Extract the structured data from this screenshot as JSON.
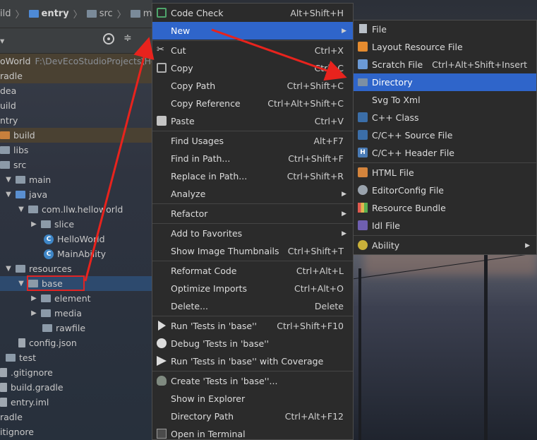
{
  "breadcrumb": {
    "seg0": "ild",
    "seg1": "entry",
    "seg2": "src",
    "seg3": "main"
  },
  "tree": {
    "root_label": "oWorld",
    "root_path": "F:\\DevEcoStudioProjects\\Hell",
    "rows": [
      "radle",
      "dea",
      "uild",
      "ntry",
      "build",
      "libs",
      "src",
      "main",
      "java",
      "com.llw.helloworld",
      "slice",
      "HelloWorld",
      "MainAbility",
      "resources",
      "base",
      "element",
      "media",
      "rawfile",
      "config.json",
      "test",
      ".gitignore",
      "build.gradle",
      "entry.iml",
      "radle",
      "itignore"
    ]
  },
  "menu": {
    "items": [
      {
        "label": "Code Check",
        "shortcut": "Alt+Shift+H"
      },
      {
        "label": "New",
        "shortcut": ""
      },
      {
        "label": "Cut",
        "shortcut": "Ctrl+X"
      },
      {
        "label": "Copy",
        "shortcut": "Ctrl+C"
      },
      {
        "label": "Copy Path",
        "shortcut": "Ctrl+Shift+C"
      },
      {
        "label": "Copy Reference",
        "shortcut": "Ctrl+Alt+Shift+C"
      },
      {
        "label": "Paste",
        "shortcut": "Ctrl+V"
      },
      {
        "label": "Find Usages",
        "shortcut": "Alt+F7"
      },
      {
        "label": "Find in Path...",
        "shortcut": "Ctrl+Shift+F"
      },
      {
        "label": "Replace in Path...",
        "shortcut": "Ctrl+Shift+R"
      },
      {
        "label": "Analyze",
        "shortcut": ""
      },
      {
        "label": "Refactor",
        "shortcut": ""
      },
      {
        "label": "Add to Favorites",
        "shortcut": ""
      },
      {
        "label": "Show Image Thumbnails",
        "shortcut": "Ctrl+Shift+T"
      },
      {
        "label": "Reformat Code",
        "shortcut": "Ctrl+Alt+L"
      },
      {
        "label": "Optimize Imports",
        "shortcut": "Ctrl+Alt+O"
      },
      {
        "label": "Delete...",
        "shortcut": "Delete"
      },
      {
        "label": "Run 'Tests in 'base''",
        "shortcut": "Ctrl+Shift+F10"
      },
      {
        "label": "Debug 'Tests in 'base''",
        "shortcut": ""
      },
      {
        "label": "Run 'Tests in 'base'' with Coverage",
        "shortcut": ""
      },
      {
        "label": "Create 'Tests in 'base''...",
        "shortcut": ""
      },
      {
        "label": "Show in Explorer",
        "shortcut": ""
      },
      {
        "label": "Directory Path",
        "shortcut": "Ctrl+Alt+F12"
      },
      {
        "label": "Open in Terminal",
        "shortcut": ""
      }
    ]
  },
  "submenu": {
    "items": [
      {
        "label": "File",
        "shortcut": ""
      },
      {
        "label": "Layout Resource File",
        "shortcut": ""
      },
      {
        "label": "Scratch File",
        "shortcut": "Ctrl+Alt+Shift+Insert"
      },
      {
        "label": "Directory",
        "shortcut": ""
      },
      {
        "label": "Svg To Xml",
        "shortcut": ""
      },
      {
        "label": "C++ Class",
        "shortcut": ""
      },
      {
        "label": "C/C++ Source File",
        "shortcut": ""
      },
      {
        "label": "C/C++ Header File",
        "shortcut": ""
      },
      {
        "label": "HTML File",
        "shortcut": ""
      },
      {
        "label": "EditorConfig File",
        "shortcut": ""
      },
      {
        "label": "Resource Bundle",
        "shortcut": ""
      },
      {
        "label": "Idl File",
        "shortcut": ""
      },
      {
        "label": "Ability",
        "shortcut": ""
      }
    ]
  },
  "icons": {
    "h_badge": "H",
    "c_badge": "C"
  }
}
